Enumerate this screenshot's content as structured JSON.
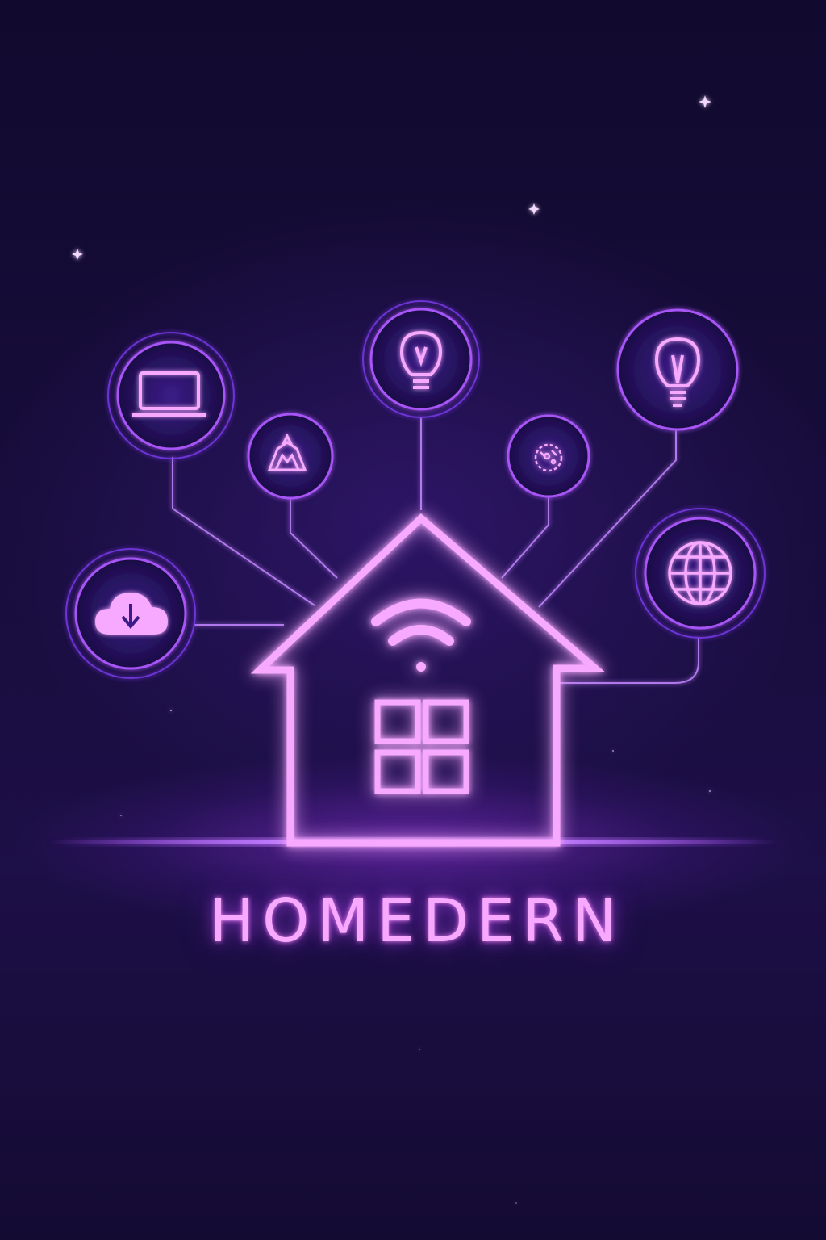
{
  "brand": {
    "name": "HOMEDERN"
  },
  "colors": {
    "background": "#140b33",
    "neon_pink": "#f7a8ff",
    "neon_purple": "#a855f7",
    "ring": "#8b5cf6"
  },
  "icons": [
    "laptop-icon",
    "pyramid-device-icon",
    "light-bulb-icon",
    "gear-chip-icon",
    "light-bulb-icon",
    "cloud-download-icon",
    "globe-icon",
    "wifi-icon",
    "window-icon"
  ]
}
